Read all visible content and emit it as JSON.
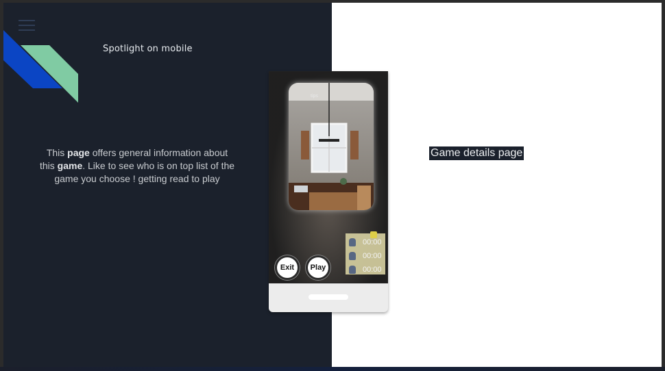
{
  "header": {
    "app_title": "Spotlight on mobile",
    "menu_icon": "hamburger-menu-icon"
  },
  "intro": {
    "p1": "This ",
    "b1": "page",
    "p2": " offers general information about this ",
    "b2": "game",
    "p3": ". Like  to see who is on top list of the game you choose !  getting read to play"
  },
  "phone": {
    "tips_label": "tips",
    "leaderboard": [
      {
        "time": "00:00"
      },
      {
        "time": "00:00"
      },
      {
        "time": "00:00"
      }
    ],
    "exit_label": "Exit",
    "play_label": "Play"
  },
  "right": {
    "detail_label": "Game details page"
  },
  "colors": {
    "left_bg": "#1b212c",
    "right_bg": "#ffffff",
    "logo_blue": "#0b45c4",
    "logo_green": "#80cba3",
    "leaderboard_bg": "#cfc99c"
  }
}
